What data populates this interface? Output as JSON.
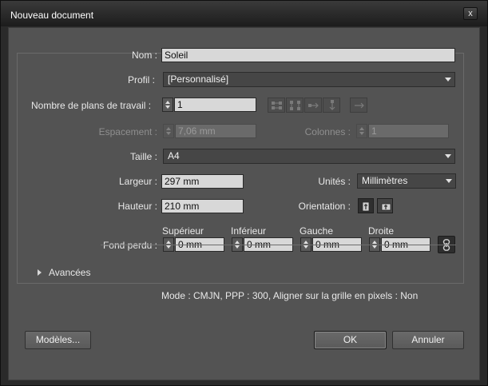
{
  "window": {
    "title": "Nouveau document",
    "close_glyph": "x"
  },
  "nom": {
    "label": "Nom :",
    "value": "Soleil"
  },
  "profil": {
    "label": "Profil :",
    "value": "[Personnalisé]"
  },
  "plans": {
    "label": "Nombre de plans de travail :",
    "value": "1"
  },
  "espacement": {
    "label": "Espacement :",
    "value": "7,06 mm"
  },
  "colonnes": {
    "label": "Colonnes :",
    "value": "1"
  },
  "taille": {
    "label": "Taille :",
    "value": "A4"
  },
  "largeur": {
    "label": "Largeur :",
    "value": "297 mm"
  },
  "unites": {
    "label": "Unités :",
    "value": "Millimètres"
  },
  "hauteur": {
    "label": "Hauteur :",
    "value": "210 mm"
  },
  "orientation": {
    "label": "Orientation :"
  },
  "fond_perdu": {
    "label": "Fond perdu :",
    "superieur": {
      "label": "Supérieur",
      "value": "0 mm"
    },
    "inferieur": {
      "label": "Inférieur",
      "value": "0 mm"
    },
    "gauche": {
      "label": "Gauche",
      "value": "0 mm"
    },
    "droite": {
      "label": "Droite",
      "value": "0 mm"
    }
  },
  "avancees": {
    "label": "Avancées"
  },
  "summary": "Mode : CMJN, PPP : 300, Aligner sur la grille en pixels : Non",
  "buttons": {
    "modeles": "Modèles...",
    "ok": "OK",
    "annuler": "Annuler"
  }
}
